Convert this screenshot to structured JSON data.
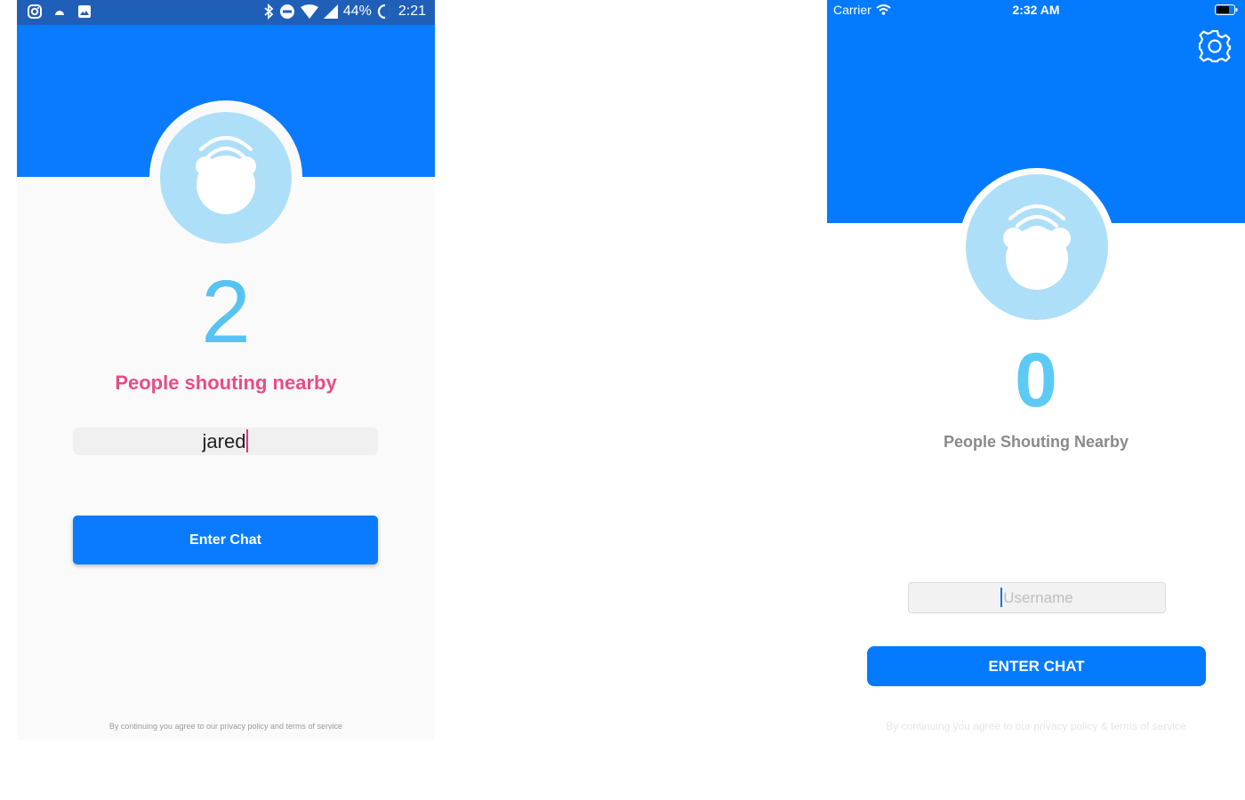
{
  "colors": {
    "android_status_bar": "#1f5fb8",
    "header_blue": "#0a7bff",
    "ios_header_blue": "#037aff",
    "avatar_light_blue": "#aedff8",
    "count_blue": "#56c3f1",
    "android_label_pink": "#ea4b86",
    "ios_label_gray": "#8a8a8a"
  },
  "android": {
    "status_bar": {
      "left_icons": [
        "instagram-icon",
        "android-icon",
        "image-icon"
      ],
      "right_icons": [
        "bluetooth-icon",
        "do-not-disturb-icon",
        "wifi-icon",
        "signal-icon"
      ],
      "battery_percent": "44%",
      "time": "2:21"
    },
    "avatar_icon": "bear-broadcast-icon",
    "people_count": "2",
    "people_label": "People shouting nearby",
    "username_value": "jared",
    "enter_button": "Enter Chat",
    "footer": "By continuing you agree to our privacy policy and terms of service"
  },
  "ios": {
    "status_bar": {
      "carrier": "Carrier",
      "time": "2:32 AM"
    },
    "settings_icon": "gear-icon",
    "avatar_icon": "bear-broadcast-icon",
    "people_count": "0",
    "people_label": "People Shouting Nearby",
    "username_placeholder": "Username",
    "enter_button": "ENTER CHAT",
    "footer": "By continuing you agree to our privacy policy & terms of service"
  }
}
